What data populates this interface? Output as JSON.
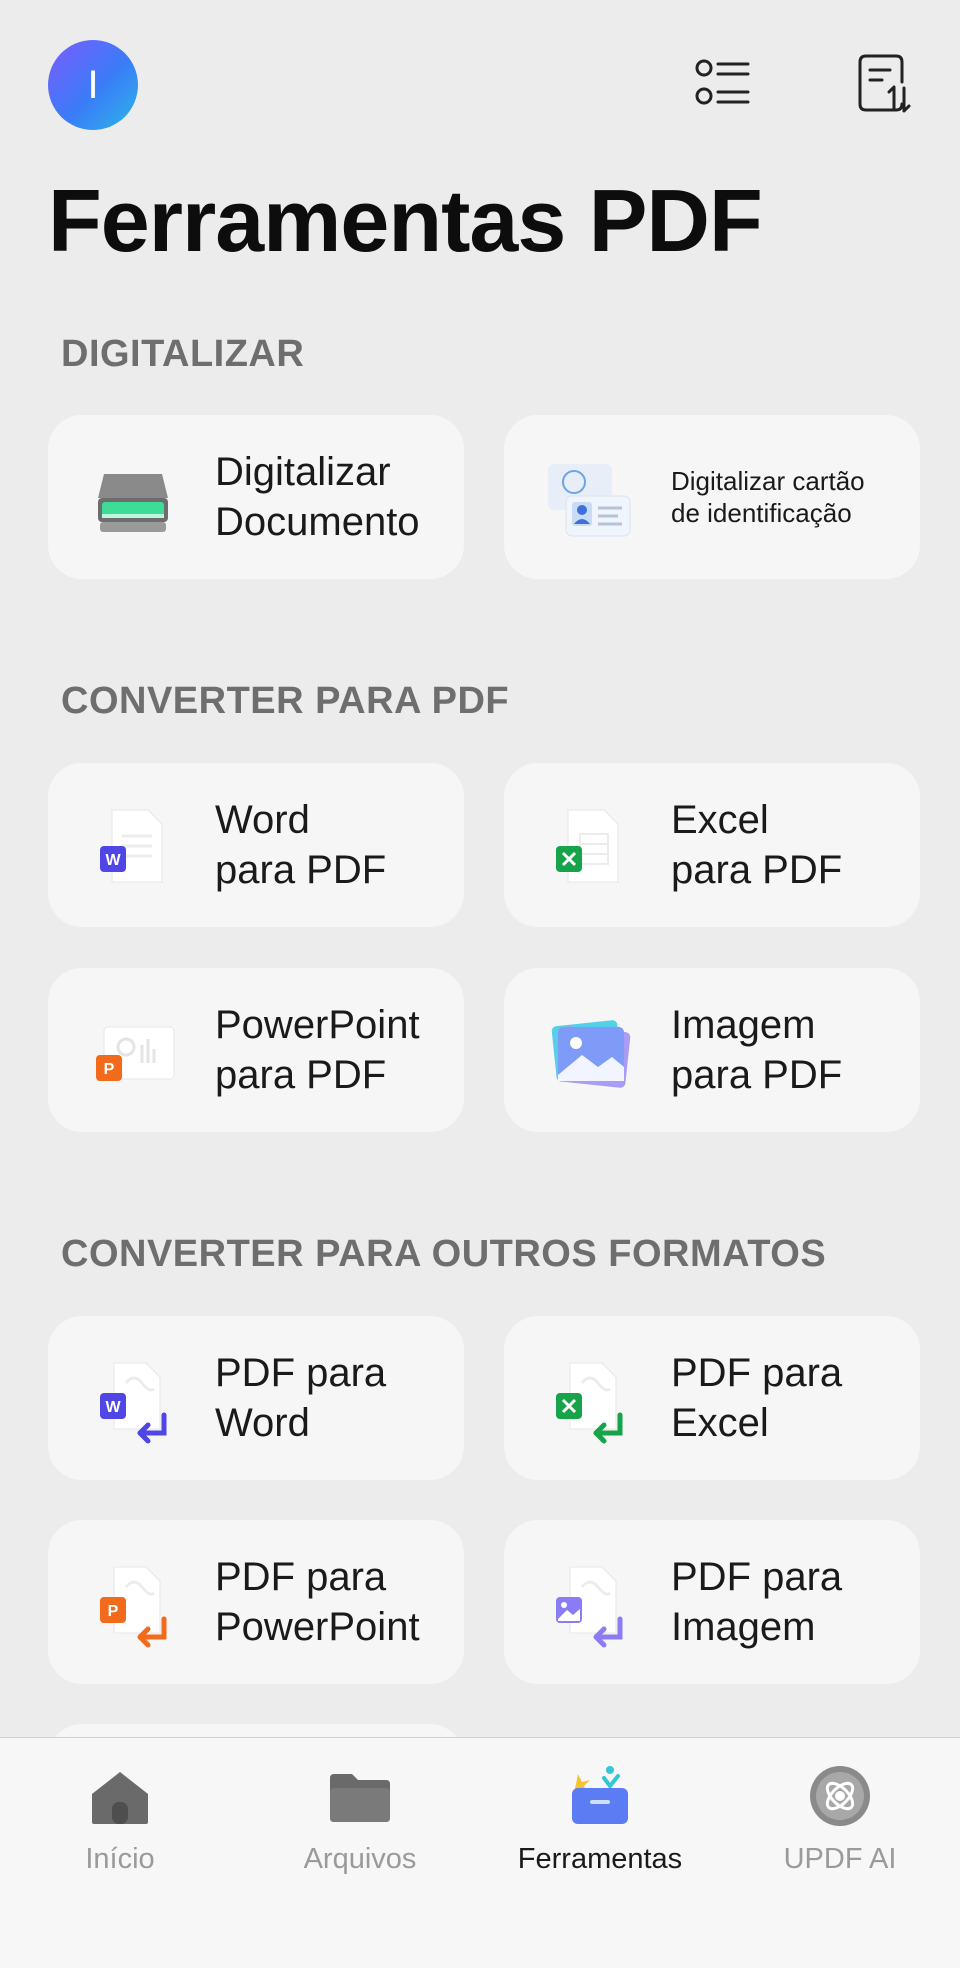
{
  "header": {
    "avatar_initial": "I",
    "title": "Ferramentas PDF",
    "list_view_icon": "list-view-icon",
    "sort_icon": "sort-document-icon"
  },
  "sections": [
    {
      "title": "DIGITALIZAR",
      "items": [
        {
          "label": "Digitalizar\nDocumento",
          "icon": "scanner-icon"
        },
        {
          "label": "Digitalizar cartão\nde identificação",
          "icon": "id-card-icon"
        }
      ]
    },
    {
      "title": "CONVERTER PARA PDF",
      "items": [
        {
          "label": "Word\npara PDF",
          "icon": "word-doc-icon"
        },
        {
          "label": "Excel\npara PDF",
          "icon": "excel-doc-icon"
        },
        {
          "label": "PowerPoint\npara PDF",
          "icon": "powerpoint-doc-icon"
        },
        {
          "label": "Imagem\npara PDF",
          "icon": "image-doc-icon"
        }
      ]
    },
    {
      "title": "CONVERTER PARA OUTROS FORMATOS",
      "items": [
        {
          "label": "PDF para\nWord",
          "icon": "pdf-to-word-icon"
        },
        {
          "label": "PDF para\nExcel",
          "icon": "pdf-to-excel-icon"
        },
        {
          "label": "PDF para\nPowerPoint",
          "icon": "pdf-to-powerpoint-icon"
        },
        {
          "label": "PDF para\nImagem",
          "icon": "pdf-to-image-icon"
        }
      ]
    }
  ],
  "tabbar": {
    "tabs": [
      {
        "label": "Início",
        "icon": "home-icon",
        "active": false
      },
      {
        "label": "Arquivos",
        "icon": "folder-icon",
        "active": false
      },
      {
        "label": "Ferramentas",
        "icon": "toolbox-icon",
        "active": true
      },
      {
        "label": "UPDF AI",
        "icon": "ai-icon",
        "active": false
      }
    ]
  },
  "colors": {
    "background": "#ececec",
    "card": "#f6f6f6",
    "word": "#4f46e5",
    "excel": "#16a34a",
    "powerpoint": "#f26a1b",
    "image": "#8b7cf6"
  }
}
